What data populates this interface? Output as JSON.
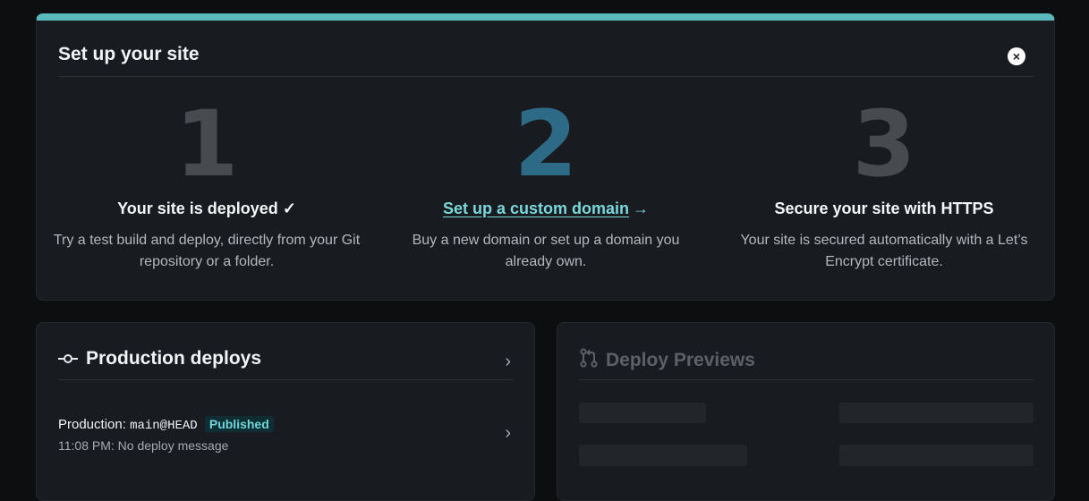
{
  "setup": {
    "title": "Set up your site",
    "close_icon": "×",
    "steps": [
      {
        "number": "1",
        "title": "Your site is deployed",
        "check": "✓",
        "desc": "Try a test build and deploy, directly from your Git repository or a folder.",
        "color": "#474b50"
      },
      {
        "number": "2",
        "title": "Set up a custom domain",
        "arrow": "→",
        "desc": "Buy a new domain or set up a domain you already own.",
        "color": "#2d6a86"
      },
      {
        "number": "3",
        "title": "Secure your site with HTTPS",
        "desc": "Your site is secured automatically with a Let’s Encrypt certificate.",
        "color": "#474b50"
      }
    ]
  },
  "production": {
    "title": "Production deploys",
    "chevron": "›",
    "deploy": {
      "label": "Production:",
      "ref": "main@HEAD",
      "status": "Published",
      "meta": "11:08 PM: No deploy message"
    }
  },
  "previews": {
    "title": "Deploy Previews"
  },
  "colors": {
    "accent": "#5ab9bc",
    "link": "#7ad7da",
    "badge_bg": "#0f2e34"
  }
}
